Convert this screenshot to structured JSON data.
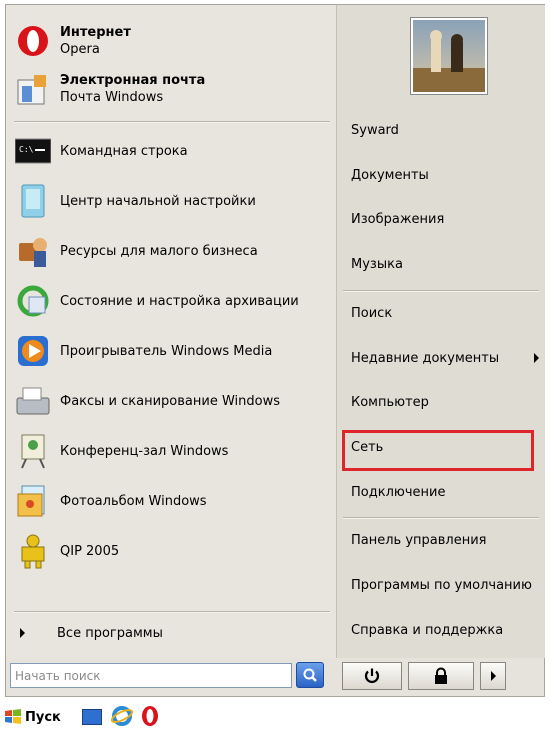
{
  "pinned": [
    {
      "title": "Интернет",
      "subtitle": "Opera",
      "icon": "opera-icon"
    },
    {
      "title": "Электронная почта",
      "subtitle": "Почта Windows",
      "icon": "mail-icon"
    }
  ],
  "programs": [
    {
      "label": "Командная строка",
      "icon": "command-prompt-icon"
    },
    {
      "label": "Центр начальной настройки",
      "icon": "initial-config-icon"
    },
    {
      "label": "Ресурсы для малого бизнеса",
      "icon": "business-resources-icon"
    },
    {
      "label": "Состояние и настройка архивации",
      "icon": "backup-icon"
    },
    {
      "label": "Проигрыватель Windows Media",
      "icon": "media-player-icon"
    },
    {
      "label": "Факсы и сканирование Windows",
      "icon": "fax-scan-icon"
    },
    {
      "label": "Конференц-зал Windows",
      "icon": "meeting-space-icon"
    },
    {
      "label": "Фотоальбом Windows",
      "icon": "photo-gallery-icon"
    },
    {
      "label": "QIP 2005",
      "icon": "qip-icon"
    }
  ],
  "all_programs_label": "Все программы",
  "search": {
    "placeholder": "Начать поиск"
  },
  "user_avatar": "chess-avatar",
  "right_menu": {
    "user": "Syward",
    "documents": "Документы",
    "pictures": "Изображения",
    "music": "Музыка",
    "search": "Поиск",
    "recent": "Недавние документы",
    "computer": "Компьютер",
    "network": "Сеть",
    "connect": "Подключение",
    "control_panel": "Панель управления",
    "default_programs": "Программы по умолчанию",
    "help": "Справка и поддержка"
  },
  "taskbar": {
    "start_label": "Пуск"
  },
  "colors": {
    "highlight": "#e0242b",
    "menu_bg": "#e6e3dc"
  }
}
